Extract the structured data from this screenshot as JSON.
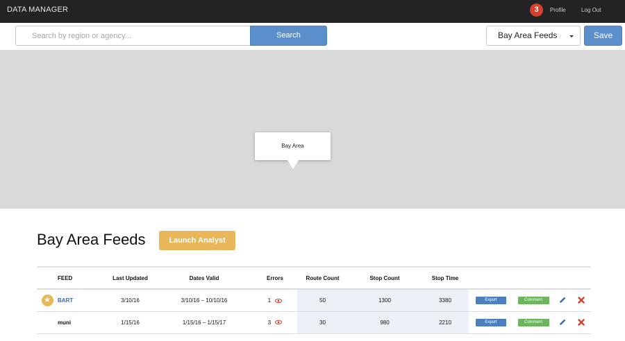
{
  "header": {
    "app_title": "DATA MANAGER",
    "notification_count": "3",
    "profile_label": "Profile",
    "logout_label": "Log Out"
  },
  "search": {
    "placeholder": "Search by region or agency...",
    "button_label": "Search"
  },
  "feed_selector": {
    "selected": "Bay Area Feeds"
  },
  "save_label": "Save",
  "map": {
    "popup_label": "Bay Area"
  },
  "section": {
    "title": "Bay Area Feeds",
    "launch_label": "Launch Analyst"
  },
  "table": {
    "headers": {
      "feed": "FEED",
      "last_updated": "Last Updated",
      "dates_valid": "Dates Valid",
      "errors": "Errors",
      "route_count": "Route Count",
      "stop_count": "Stop Count",
      "stop_time": "Stop Time"
    },
    "rows": [
      {
        "starred": true,
        "feed": "BART",
        "last_updated": "3/10/16",
        "dates_valid": "3/10/16 – 10/10/16",
        "errors": "1",
        "route_count": "50",
        "stop_count": "1300",
        "stop_time": "3380",
        "export_label": "Export",
        "comment_label": "Comment"
      },
      {
        "starred": false,
        "feed": "muni",
        "last_updated": "1/15/16",
        "dates_valid": "1/15/16 – 1/15/17",
        "errors": "3",
        "route_count": "30",
        "stop_count": "980",
        "stop_time": "2210",
        "export_label": "Export",
        "comment_label": "Comment"
      }
    ]
  },
  "icons": {
    "star": "star-icon",
    "errors": "eye-icon",
    "edit": "pencil-icon",
    "delete": "close-icon"
  },
  "colors": {
    "topbar": "#232323",
    "primary": "#5b8fcc",
    "accent": "#e8b75a",
    "badge": "#d8402d",
    "export": "#4d7ebf",
    "comment": "#6db55c",
    "delete": "#d8402d",
    "map": "#d9d9d9"
  }
}
